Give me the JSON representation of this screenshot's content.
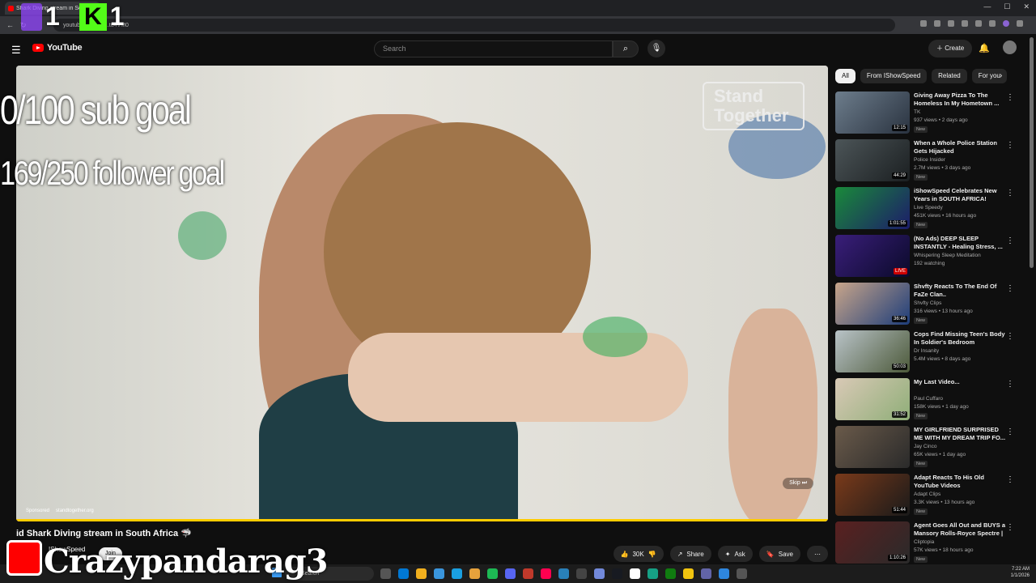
{
  "browser": {
    "tab_title": "Shark Diving stream in So",
    "url": "youtube.com/wa...tu4VM0"
  },
  "stream_overlay": {
    "twitch_count": "1",
    "kick_count": "1",
    "sub_goal": "0/100 sub goal",
    "follower_goal": "169/250 follower goal",
    "streamer_name": "Crazypandarag3"
  },
  "youtube": {
    "logo_text": "YouTube",
    "search_placeholder": "Search",
    "create_label": "Create"
  },
  "player": {
    "ad_logo_line1": "Stand",
    "ad_logo_line2": "Together",
    "sponsored": "Sponsored",
    "ad_url": "standtogether.org",
    "skip_label": "Skip",
    "progress": 1.0
  },
  "video": {
    "title": "id Shark Diving stream in South Africa 🦈",
    "channel": "IShowSpeed",
    "join_label": "Join",
    "likes": "30K",
    "share_label": "Share",
    "ask_label": "Ask",
    "save_label": "Save"
  },
  "chips": [
    "All",
    "From IShowSpeed",
    "Related",
    "For you"
  ],
  "recommendations": [
    {
      "title": "Giving Away Pizza To The Homeless In My Hometown ...",
      "channel": "TK",
      "meta": "937 views • 2 days ago",
      "badge": "New",
      "duration": "12:15",
      "c1": "#6d7d8c",
      "c2": "#2a3340"
    },
    {
      "title": "When a Whole Police Station Gets Hijacked",
      "channel": "Police Insider",
      "meta": "2.7M views • 3 days ago",
      "badge": "New",
      "duration": "44:29",
      "c1": "#4c5558",
      "c2": "#1b1f21"
    },
    {
      "title": "iShowSpeed Celebrates New Years in SOUTH AFRICA!",
      "channel": "Live Speedy",
      "meta": "451K views • 16 hours ago",
      "badge": "New",
      "duration": "1:01:55",
      "c1": "#1a8a3a",
      "c2": "#1c1c6a"
    },
    {
      "title": "(No Ads) DEEP SLEEP INSTANTLY - Healing Stress, ...",
      "channel": "Whispering Sleep Meditation",
      "meta": "192 watching",
      "badge": "",
      "duration": "LIVE",
      "c1": "#3a1e7a",
      "c2": "#0a0a2a"
    },
    {
      "title": "Shvfty Reacts To The End Of FaZe Clan..",
      "channel": "Shvfty Clips",
      "meta": "316 views • 13 hours ago",
      "badge": "New",
      "duration": "36:46",
      "c1": "#c8a58a",
      "c2": "#1d3d7a"
    },
    {
      "title": "Cops Find Missing Teen's Body In Soldier's Bedroom",
      "channel": "Dr Insanity",
      "meta": "5.4M views • 8 days ago",
      "badge": "",
      "duration": "50:03",
      "c1": "#b9c3c8",
      "c2": "#4d5a3a"
    },
    {
      "title": "My Last Video...",
      "channel": "Paul Cuffaro",
      "meta": "158K views • 1 day ago",
      "badge": "New",
      "duration": "31:52",
      "c1": "#d9c9b6",
      "c2": "#8fae78"
    },
    {
      "title": "MY GIRLFRIEND SURPRISED ME WITH MY DREAM TRIP FO...",
      "channel": "Jay Cinco",
      "meta": "65K views • 1 day ago",
      "badge": "New",
      "duration": "",
      "c1": "#6a5a4a",
      "c2": "#2a2a2a"
    },
    {
      "title": "Adapt Reacts To His Old YouTube Videos",
      "channel": "Adapt Clips",
      "meta": "3.3K views • 13 hours ago",
      "badge": "New",
      "duration": "51:44",
      "c1": "#7a3a1a",
      "c2": "#1a1a1a"
    },
    {
      "title": "Agent Goes All Out and BUYS a Mansory Rolls-Royce Spectre | ...",
      "channel": "Cliptopia",
      "meta": "57K views • 18 hours ago",
      "badge": "New",
      "duration": "1:10:26",
      "c1": "#5a2020",
      "c2": "#2a2a2a"
    }
  ],
  "taskbar": {
    "search_label": "Search",
    "time": "7:22 AM",
    "date": "1/1/2026"
  },
  "colors": {
    "twitch": "#9146ff",
    "kick": "#53fc18",
    "youtube_red": "#ff0000",
    "progress": "#ffcc00"
  }
}
